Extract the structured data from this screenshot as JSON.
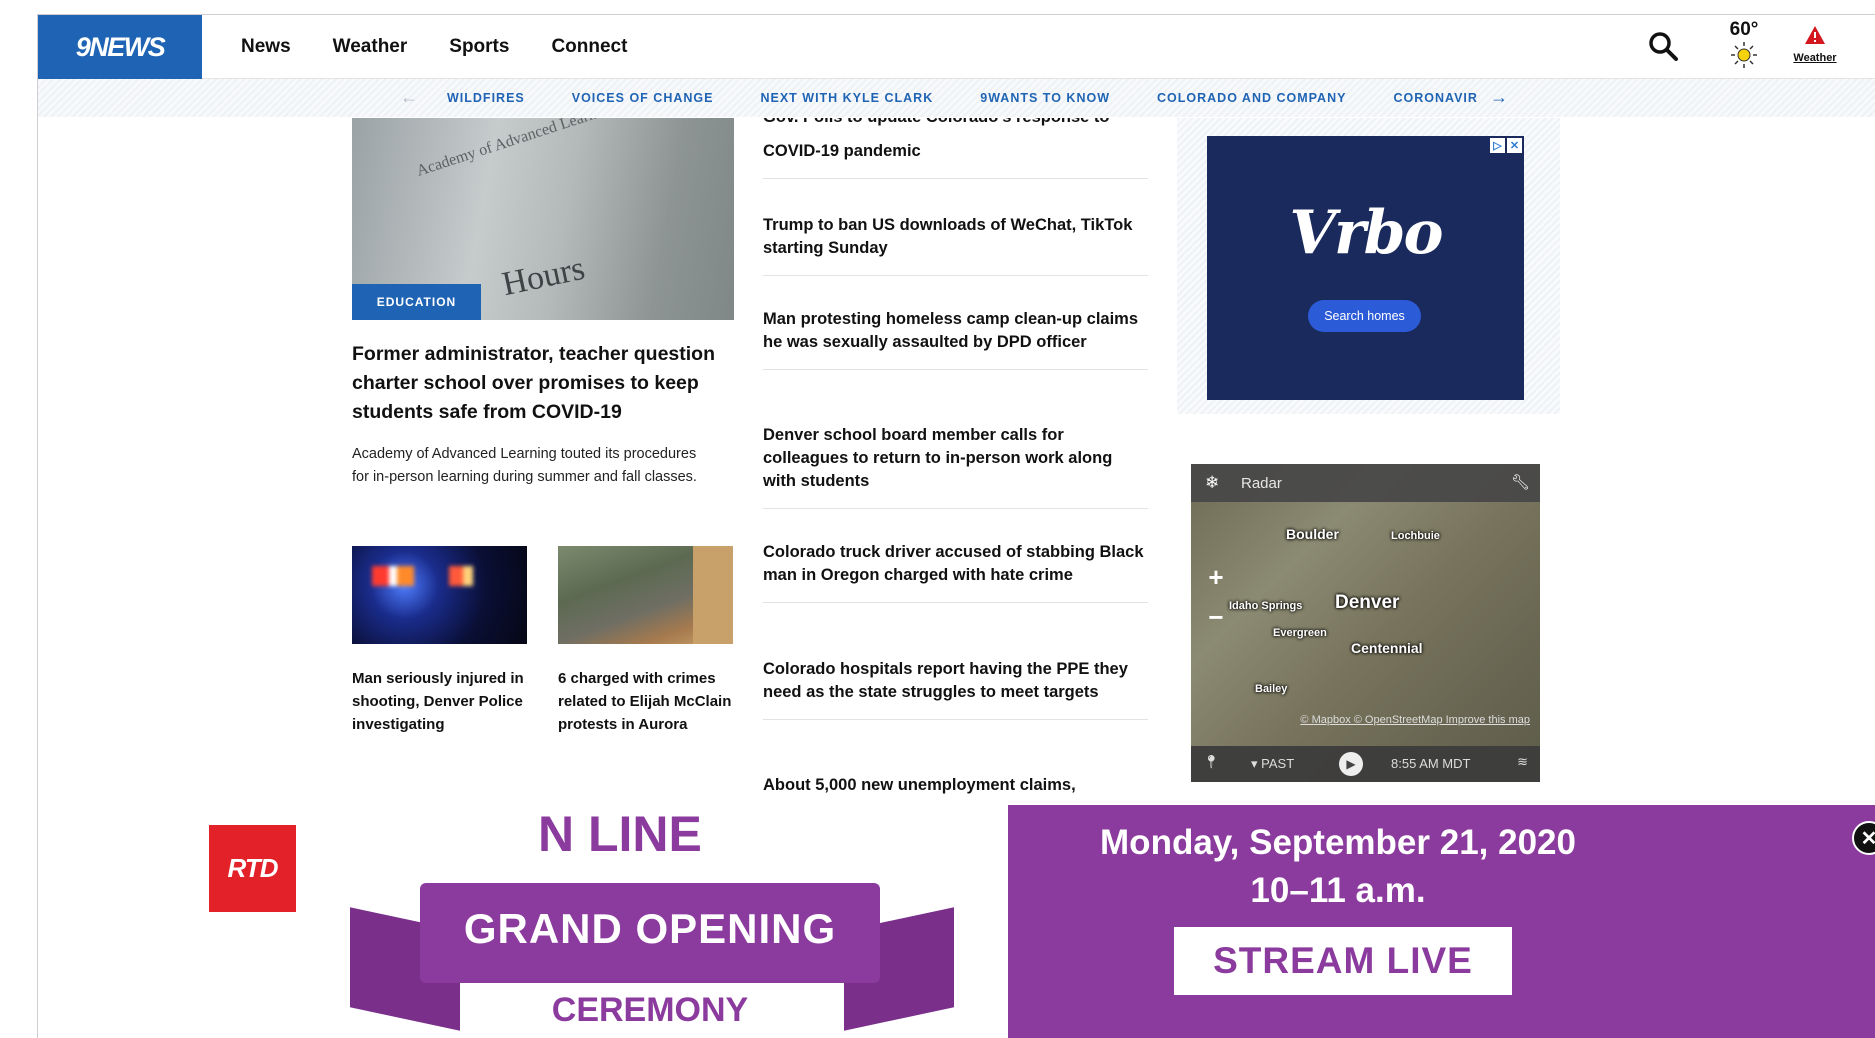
{
  "header": {
    "logo": "9NEWS",
    "nav": [
      "News",
      "Weather",
      "Sports",
      "Connect"
    ],
    "temperature": "60°",
    "alert_label": "Weather"
  },
  "subnav": {
    "items": [
      "WILDFIRES",
      "VOICES OF CHANGE",
      "NEXT WITH KYLE CLARK",
      "9WANTS TO KNOW",
      "COLORADO AND COMPANY",
      "CORONAVIRU"
    ]
  },
  "lead": {
    "image_sign_1": "Academy of Advanced Learning",
    "image_sign_2": "Hours",
    "tag": "EDUCATION",
    "title": "Former administrator, teacher question charter school over promises to keep students safe from COVID-19",
    "description": "Academy of Advanced Learning touted its procedures for in-person learning during summer and fall classes."
  },
  "thumbs": [
    {
      "caption": "Man seriously injured in shooting, Denver Police investigating"
    },
    {
      "caption": "6 charged with crimes related to Elijah McClain protests in Aurora"
    }
  ],
  "headlines": {
    "top_cut": "Gov. Polis to update Colorado's response to",
    "items": [
      "COVID-19 pandemic",
      "Trump to ban US downloads of WeChat, TikTok starting Sunday",
      "Man protesting homeless camp clean-up claims he was sexually assaulted by DPD officer",
      "Denver school board member calls for colleagues to return to in-person work along with students",
      "Colorado truck driver accused of stabbing Black man in Oregon charged with hate crime",
      "Colorado hospitals report having the PPE they need as the state struggles to meet targets",
      "About 5,000 new unemployment claims,"
    ]
  },
  "ad": {
    "brand": "Vrbo",
    "button": "Search homes"
  },
  "radar": {
    "title": "Radar",
    "cities": [
      "Boulder",
      "Lochbuie",
      "Denver",
      "Idaho Springs",
      "Evergreen",
      "Centennial",
      "Bailey"
    ],
    "credits": "© Mapbox © OpenStreetMap Improve this map",
    "past": "PAST",
    "time": "8:55 AM MDT"
  },
  "banner": {
    "logo": "RTD",
    "line": "N LINE",
    "grand": "GRAND OPENING",
    "ceremony": "CEREMONY",
    "date": "Monday, September 21, 2020",
    "time": "10–11 a.m.",
    "cta": "STREAM LIVE"
  }
}
